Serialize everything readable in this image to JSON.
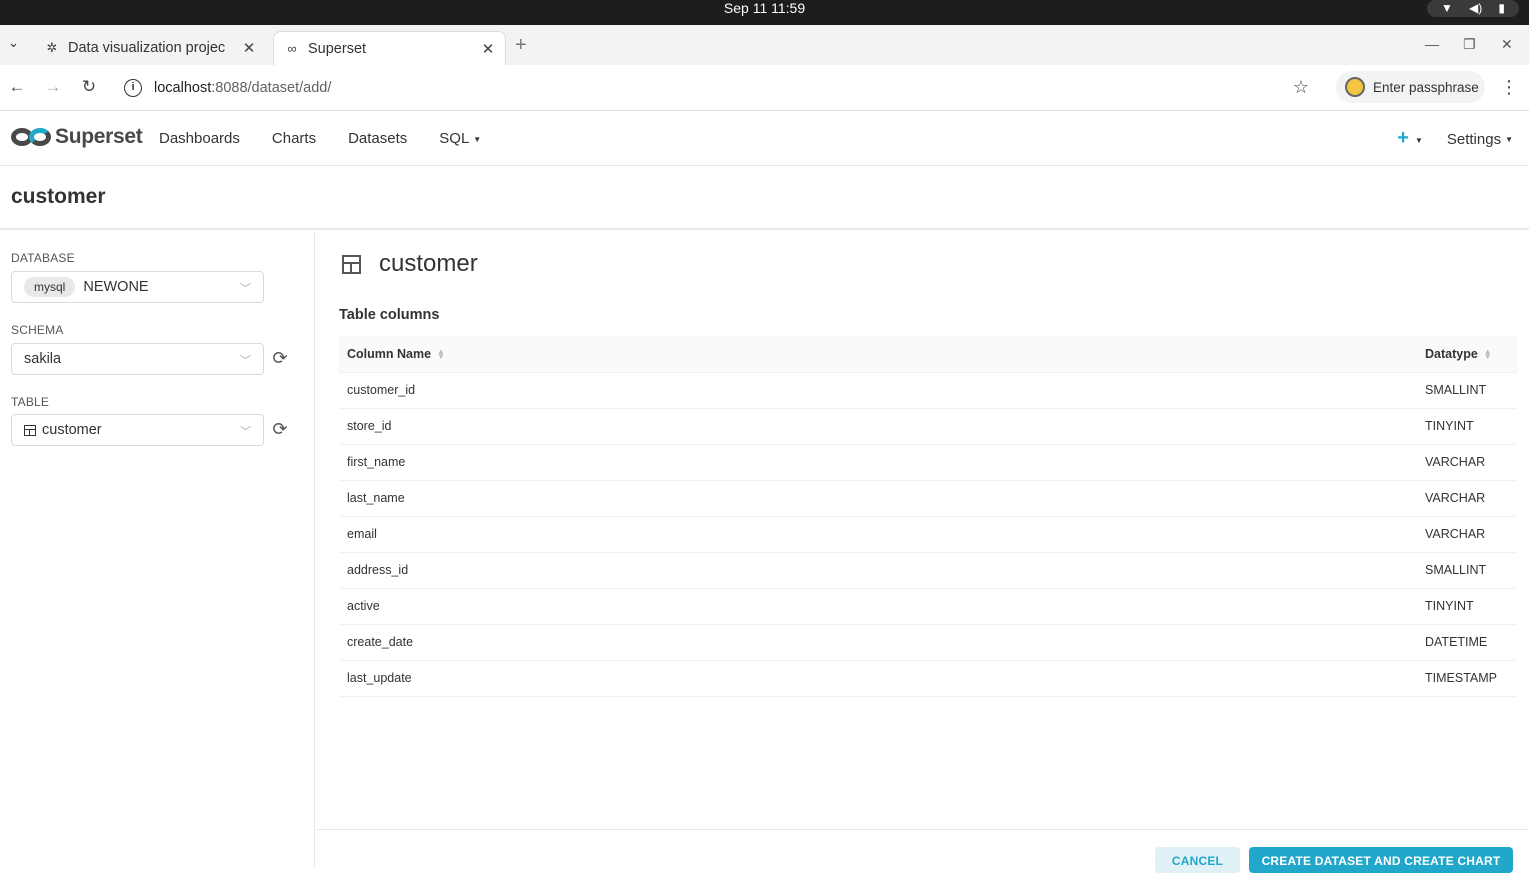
{
  "os": {
    "clock": "Sep 11  11:59"
  },
  "browser": {
    "tabs": [
      {
        "title": "Data visualization projec",
        "active": false
      },
      {
        "title": "Superset",
        "active": true
      }
    ],
    "url_host": "localhost",
    "url_rest": ":8088/dataset/add/",
    "profile_label": "Enter passphrase"
  },
  "superset_nav": {
    "logo_text": "Superset",
    "menu": [
      "Dashboards",
      "Charts",
      "Datasets",
      "SQL"
    ],
    "plus": "+",
    "settings": "Settings"
  },
  "page": {
    "title": "customer"
  },
  "left_panel": {
    "database_label": "DATABASE",
    "database_badge": "mysql",
    "database_value": "NEWONE",
    "schema_label": "SCHEMA",
    "schema_value": "sakila",
    "table_label": "TABLE",
    "table_value": "customer"
  },
  "content": {
    "dataset_title": "customer",
    "section_title": "Table columns",
    "headers": {
      "column_name": "Column Name",
      "datatype": "Datatype"
    },
    "rows": [
      {
        "name": "customer_id",
        "type": "SMALLINT"
      },
      {
        "name": "store_id",
        "type": "TINYINT"
      },
      {
        "name": "first_name",
        "type": "VARCHAR"
      },
      {
        "name": "last_name",
        "type": "VARCHAR"
      },
      {
        "name": "email",
        "type": "VARCHAR"
      },
      {
        "name": "address_id",
        "type": "SMALLINT"
      },
      {
        "name": "active",
        "type": "TINYINT"
      },
      {
        "name": "create_date",
        "type": "DATETIME"
      },
      {
        "name": "last_update",
        "type": "TIMESTAMP"
      }
    ]
  },
  "footer": {
    "cancel_label": "CANCEL",
    "create_label": "CREATE DATASET AND CREATE CHART"
  },
  "colors": {
    "accent": "#20a7c9",
    "logo_dark": "#484848"
  }
}
